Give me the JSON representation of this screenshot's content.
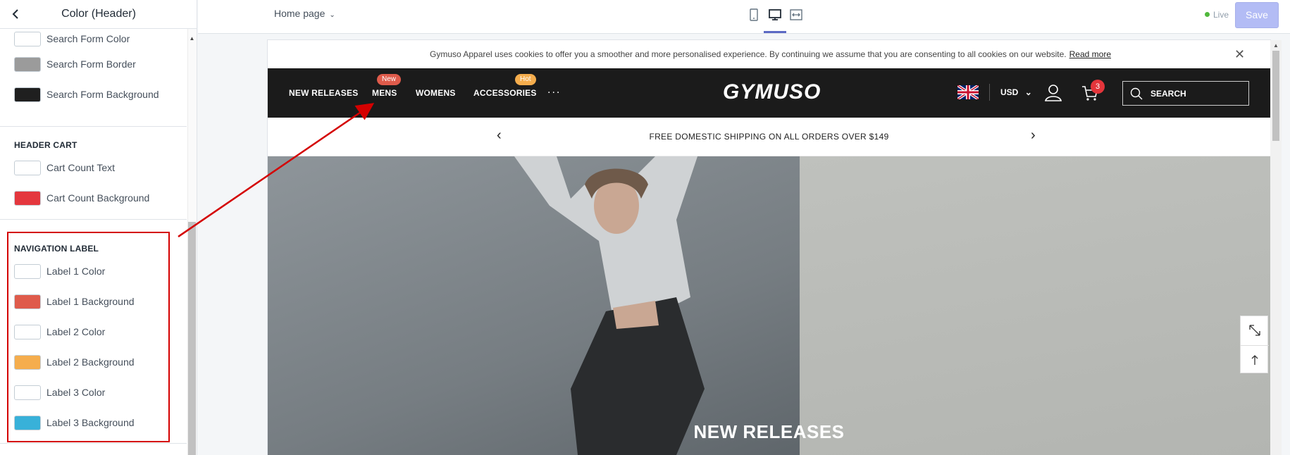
{
  "sidebar": {
    "title": "Color (Header)",
    "items_top": [
      {
        "label": "Search Form Color",
        "color": "#ffffff"
      },
      {
        "label": "Search Form Border",
        "color": "#9b9b9b"
      },
      {
        "label": "Search Form Background",
        "color": "#1f1f1f"
      }
    ],
    "header_cart": {
      "title": "HEADER CART",
      "items": [
        {
          "label": "Cart Count Text",
          "color": "#ffffff"
        },
        {
          "label": "Cart Count Background",
          "color": "#e4373e"
        }
      ]
    },
    "navigation_label": {
      "title": "NAVIGATION LABEL",
      "items": [
        {
          "label": "Label 1 Color",
          "color": "#ffffff"
        },
        {
          "label": "Label 1 Background",
          "color": "#df5b4b"
        },
        {
          "label": "Label 2 Color",
          "color": "#ffffff"
        },
        {
          "label": "Label 2 Background",
          "color": "#f5ad4d"
        },
        {
          "label": "Label 3 Color",
          "color": "#ffffff"
        },
        {
          "label": "Label 3 Background",
          "color": "#38b1d9"
        }
      ]
    }
  },
  "topbar": {
    "page": "Home page",
    "live": "Live",
    "save": "Save"
  },
  "preview": {
    "cookie": {
      "text": "Gymuso Apparel uses cookies to offer you a smoother and more personalised experience. By continuing we assume that you are consenting to all cookies on our website.",
      "link": "Read more",
      "close": "✕"
    },
    "nav": {
      "items": [
        "NEW RELEASES",
        "MENS",
        "WOMENS",
        "ACCESSORIES"
      ],
      "more": "...",
      "badges": {
        "mens": "New",
        "accessories": "Hot"
      },
      "badge_colors": {
        "mens": "#df5b4b",
        "accessories": "#f5ad4d"
      },
      "logo": "GYMUSO",
      "currency": "USD",
      "cart_count": "3",
      "search": "SEARCH"
    },
    "announcement": "FREE DOMESTIC SHIPPING ON ALL ORDERS OVER $149",
    "hero_title": "NEW RELEASES"
  }
}
